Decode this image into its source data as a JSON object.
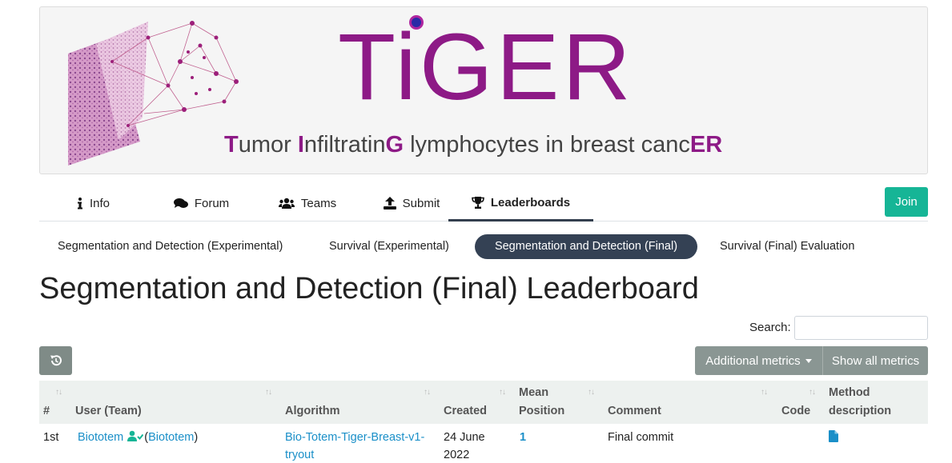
{
  "banner": {
    "title": "TiGER",
    "subtitle_parts": [
      {
        "text": "T",
        "bold": true
      },
      {
        "text": "umor ",
        "bold": false
      },
      {
        "text": "I",
        "bold": true
      },
      {
        "text": "nfiltratin",
        "bold": false
      },
      {
        "text": "G",
        "bold": true
      },
      {
        "text": " lymphocytes in breast canc",
        "bold": false
      },
      {
        "text": "ER",
        "bold": true
      }
    ],
    "accent_color": "#8d1a86"
  },
  "tabs": [
    {
      "label": "Info",
      "icon": "info-icon"
    },
    {
      "label": "Forum",
      "icon": "comments-icon"
    },
    {
      "label": "Teams",
      "icon": "users-icon"
    },
    {
      "label": "Submit",
      "icon": "upload-icon"
    },
    {
      "label": "Leaderboards",
      "icon": "trophy-icon",
      "active": true
    }
  ],
  "join_label": "Join",
  "phases": [
    {
      "label": "Segmentation and Detection (Experimental)"
    },
    {
      "label": "Survival (Experimental)"
    },
    {
      "label": "Segmentation and Detection (Final)",
      "active": true
    },
    {
      "label": "Survival (Final) Evaluation"
    }
  ],
  "page_title": "Segmentation and Detection (Final) Leaderboard",
  "search": {
    "label": "Search:",
    "value": ""
  },
  "toolbar": {
    "additional_metrics_label": "Additional metrics",
    "show_all_label": "Show all metrics"
  },
  "table": {
    "headers": {
      "rank": "#",
      "user": "User (Team)",
      "algorithm": "Algorithm",
      "created": "Created",
      "mean_position_line1": "Mean",
      "mean_position_line2": "Position",
      "comment": "Comment",
      "code": "Code",
      "method_line1": "Method",
      "method_line2": "description"
    },
    "rows": [
      {
        "rank": "1st",
        "user": "Biototem",
        "team": "Biototem",
        "algorithm_line1": "Bio-Totem-Tiger-Breast-v1-",
        "algorithm_line2": "tryout",
        "created_line1": "24 June",
        "created_line2": "2022",
        "mean_position": "1",
        "comment": "Final commit"
      }
    ]
  },
  "colors": {
    "teal": "#16b596",
    "link": "#1a8fc8",
    "dark": "#344154",
    "gray_button": "#8a9693"
  }
}
